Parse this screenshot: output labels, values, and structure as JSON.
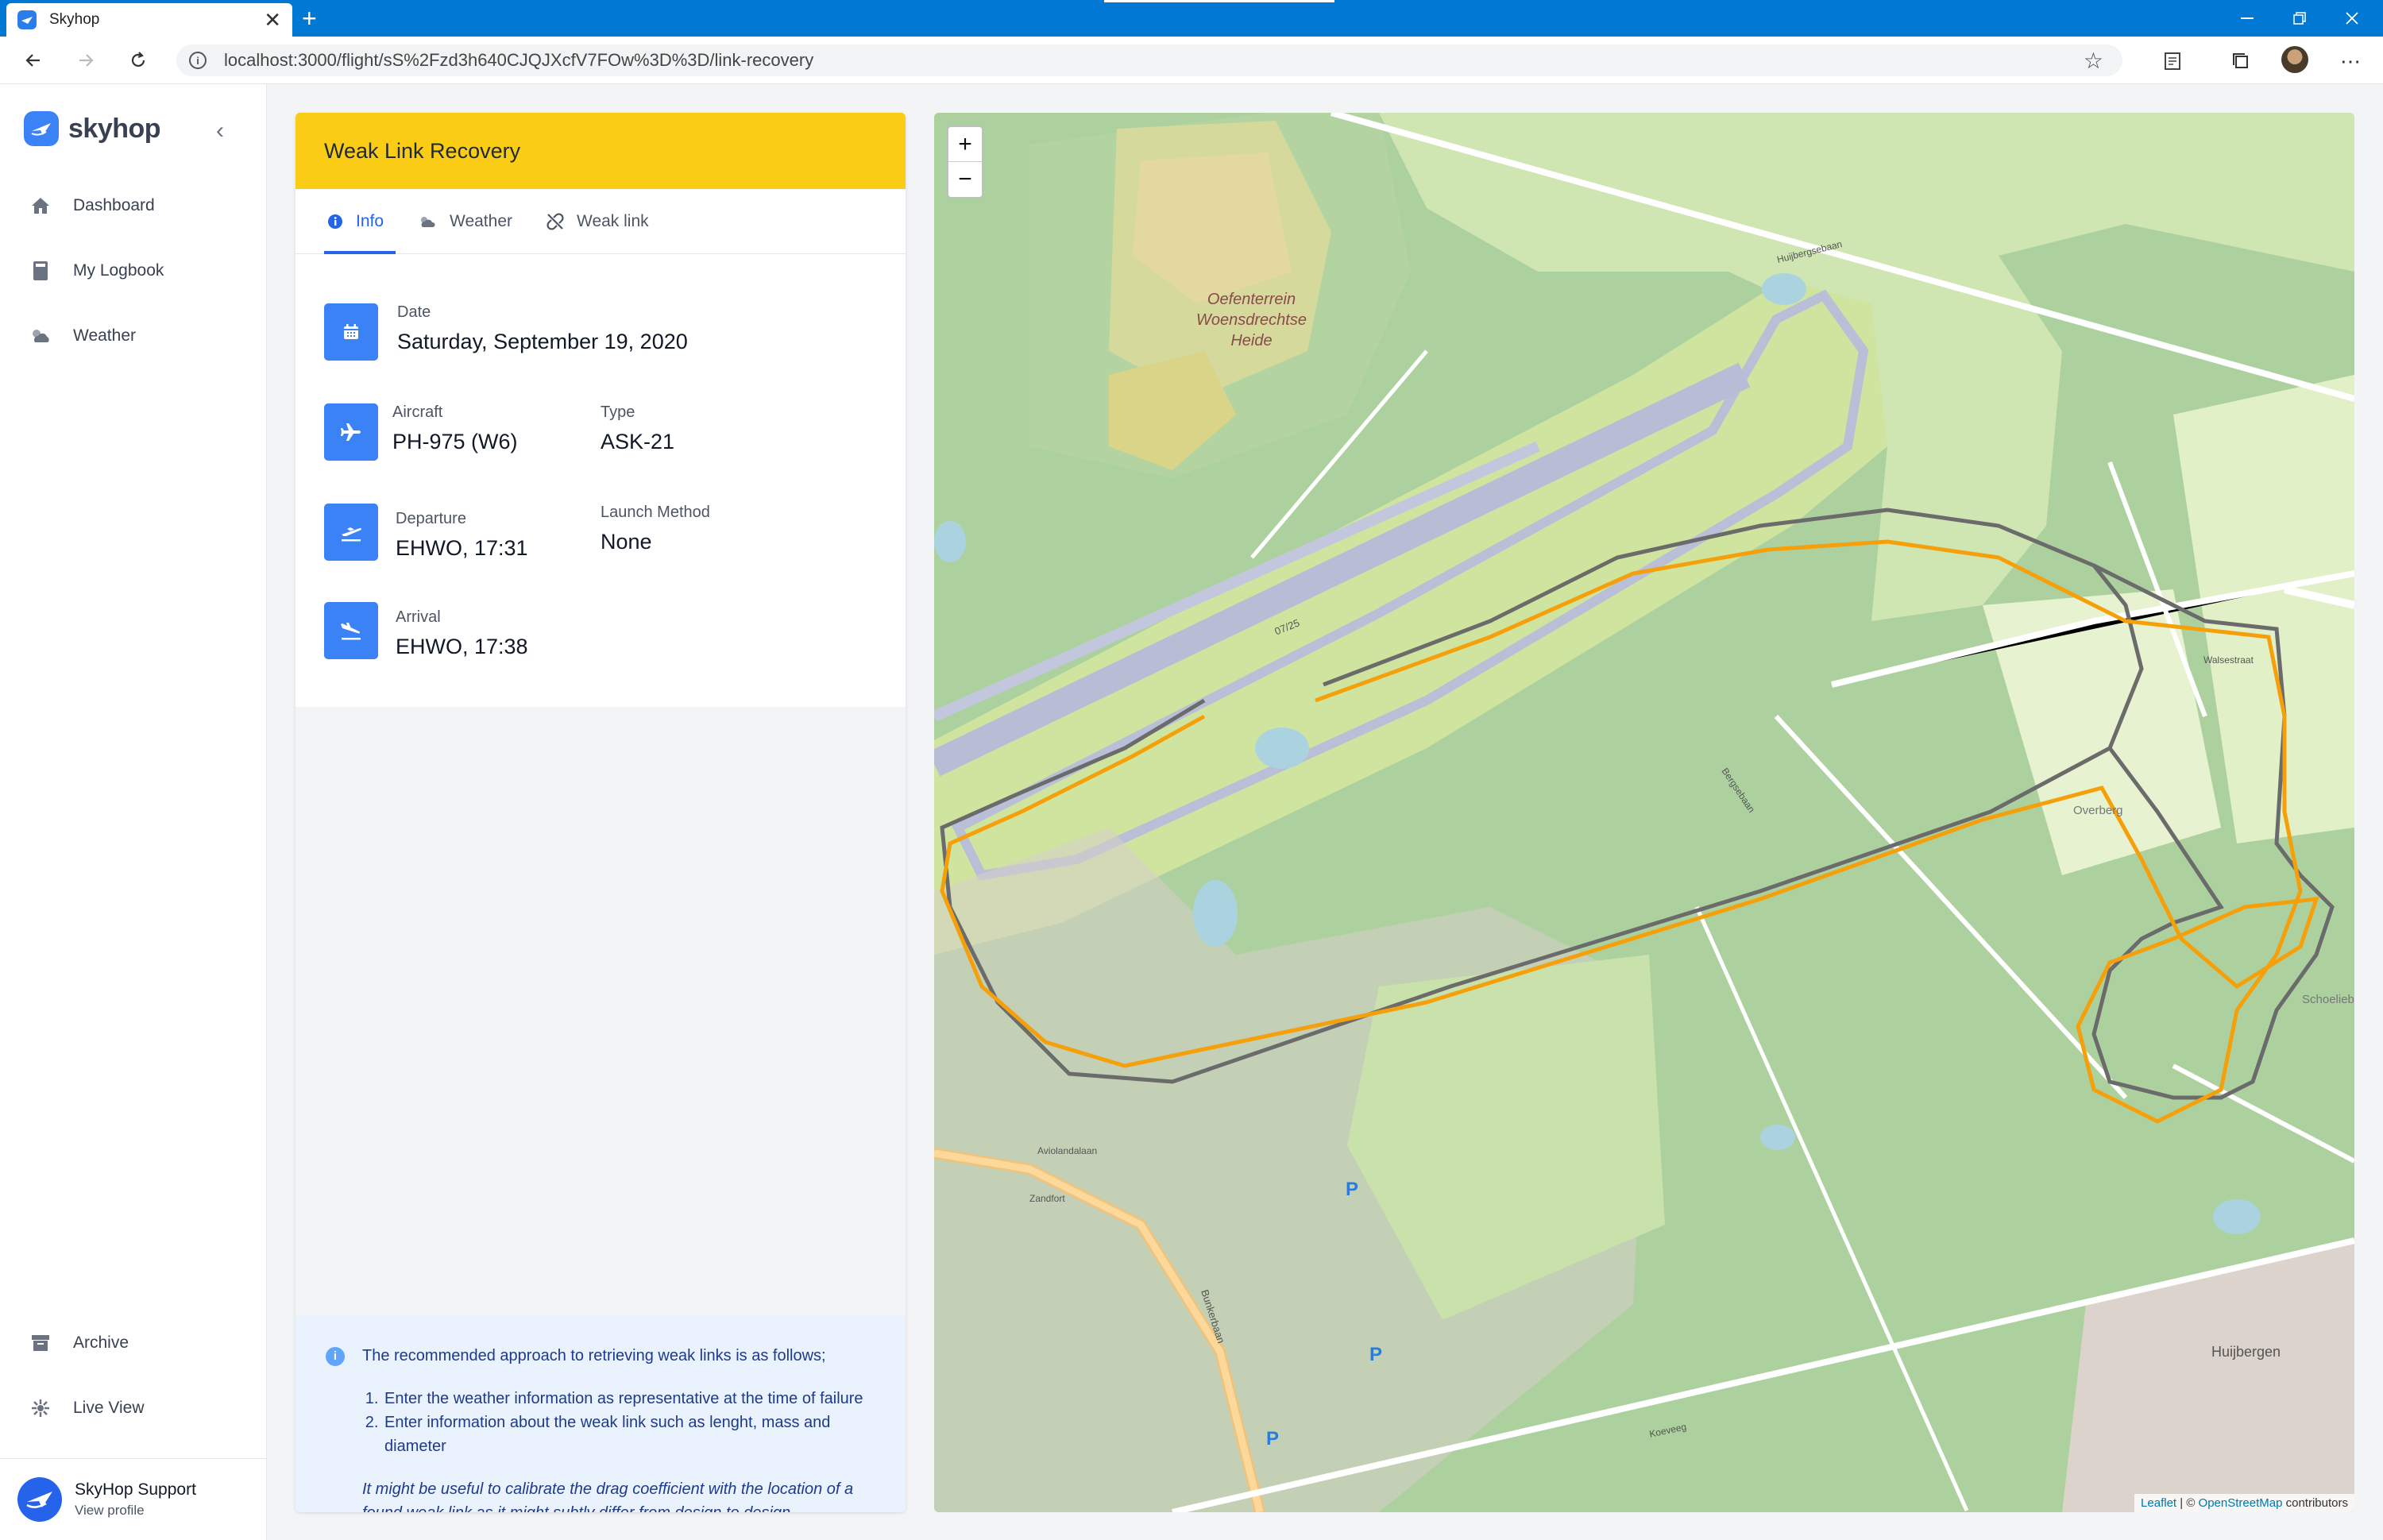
{
  "browser": {
    "tab_title": "Skyhop",
    "tab_close": "✕",
    "new_tab": "+",
    "url": "localhost:3000/flight/sS%2Fzd3h640CJQJXcfV7FOw%3D%3D/link-recovery"
  },
  "sidebar": {
    "logo_text": "skyhop",
    "nav": [
      {
        "label": "Dashboard",
        "icon": "home-icon"
      },
      {
        "label": "My Logbook",
        "icon": "book-icon"
      },
      {
        "label": "Weather",
        "icon": "cloud-sun-icon"
      }
    ],
    "bottom_nav": [
      {
        "label": "Archive",
        "icon": "archive-icon"
      },
      {
        "label": "Live View",
        "icon": "radar-icon"
      }
    ],
    "profile": {
      "name": "SkyHop Support",
      "sub": "View profile"
    }
  },
  "card": {
    "title": "Weak Link Recovery",
    "tabs": [
      {
        "label": "Info",
        "active": true
      },
      {
        "label": "Weather",
        "active": false
      },
      {
        "label": "Weak link",
        "active": false
      }
    ],
    "date": {
      "label": "Date",
      "value": "Saturday, September 19, 2020"
    },
    "aircraft": {
      "label": "Aircraft",
      "value": "PH-975 (W6)"
    },
    "type": {
      "label": "Type",
      "value": "ASK-21"
    },
    "departure": {
      "label": "Departure",
      "value": "EHWO, 17:31"
    },
    "launch_method": {
      "label": "Launch Method",
      "value": "None"
    },
    "arrival": {
      "label": "Arrival",
      "value": "EHWO, 17:38"
    },
    "notice": {
      "intro": "The recommended approach to retrieving weak links is as follows;",
      "steps": [
        "Enter the weather information as representative at the time of failure",
        "Enter information about the weak link such as lenght, mass and diameter"
      ],
      "note": "It might be useful to calibrate the drag coefficient with the location of a found weak link as it might subtly differ from design to design."
    }
  },
  "map": {
    "zoom_in": "+",
    "zoom_out": "−",
    "attribution_leaflet": "Leaflet",
    "attribution_sep": " | © ",
    "attribution_osm": "OpenStreetMap",
    "attribution_tail": " contributors",
    "labels": {
      "heath_1": "Oefenterrein",
      "heath_2": "Woensdrechtse",
      "heath_3": "Heide",
      "runway": "07/25",
      "overberg": "Overberg",
      "huijbergen": "Huijbergen",
      "schoelieb": "Schoelieb",
      "walsestraat": "Walsestraat",
      "bergsebaan": "Bergsebaan",
      "huijbergsebaan": "Huijbergsebaan",
      "aviolandalaan": "Aviolandalaan",
      "bunkerbaan": "Bunkerbaan",
      "zandfort": "Zandfort",
      "parking": "P",
      "koevoeg": "Koeveeg"
    },
    "colors": {
      "track_grey": "#6b6b6b",
      "track_orange": "#f59e0b",
      "forest": "#add19e",
      "grass": "#cdebb0"
    }
  }
}
